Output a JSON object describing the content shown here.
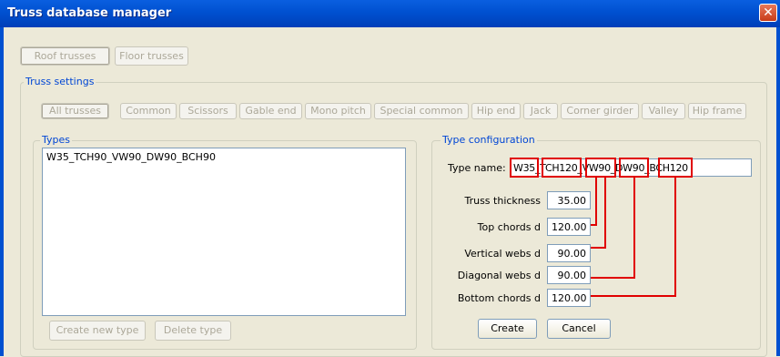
{
  "window": {
    "title": "Truss database manager",
    "close_glyph": "✕"
  },
  "top_tabs": [
    "Roof trusses",
    "Floor trusses"
  ],
  "truss_settings": {
    "legend": "Truss settings",
    "filters": [
      "All trusses",
      "Common",
      "Scissors",
      "Gable end",
      "Mono pitch",
      "Special common",
      "Hip end",
      "Jack",
      "Corner girder",
      "Valley",
      "Hip frame"
    ]
  },
  "types": {
    "legend": "Types",
    "items": [
      "W35_TCH90_VW90_DW90_BCH90"
    ],
    "create_label": "Create new type",
    "delete_label": "Delete type"
  },
  "type_config": {
    "legend": "Type configuration",
    "name_label": "Type name:",
    "name_value": "W35_TCH120_VW90_DW90_BCH120",
    "rows": [
      {
        "label": "Truss thickness",
        "value": "35.00"
      },
      {
        "label": "Top chords d",
        "value": "120.00"
      },
      {
        "label": "Vertical webs d",
        "value": "90.00"
      },
      {
        "label": "Diagonal webs d",
        "value": "90.00"
      },
      {
        "label": "Bottom chords d",
        "value": "120.00"
      }
    ],
    "create_label": "Create",
    "cancel_label": "Cancel"
  },
  "annotation_color": "#e00000"
}
